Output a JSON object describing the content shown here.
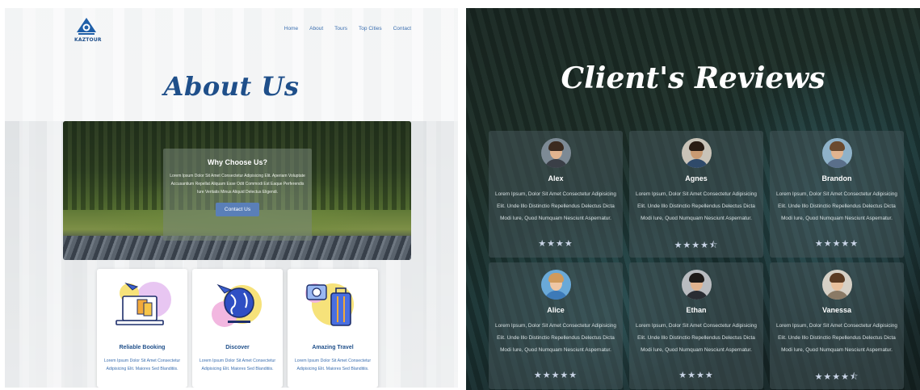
{
  "about": {
    "logo_text": "KAZTOUR",
    "nav": [
      "Home",
      "About",
      "Tours",
      "Top Cities",
      "Contact"
    ],
    "title": "About Us",
    "why": {
      "title": "Why Choose Us?",
      "text": "Lorem Ipsum Dolor Sit Amet Consectetur Adipisicing Elit. Aperiam Voluptate Accusantium Repellat Aliquam Esse Odit Commodi Est Eaque Perferendis Iure Veritatis Minus Aliquid Delectus Eligendi.",
      "button": "Contact Us"
    },
    "cards": [
      {
        "title": "Reliable Booking",
        "text": "Lorem Ipsum Dolor Sit Amet Consectetur Adipisicing Elit. Maiores Sed Blanditiis."
      },
      {
        "title": "Discover",
        "text": "Lorem Ipsum Dolor Sit Amet Consectetur Adipisicing Elit. Maiores Sed Blanditiis."
      },
      {
        "title": "Amazing Travel",
        "text": "Lorem Ipsum Dolor Sit Amet Consectetur Adipisicing Elit. Maiores Sed Blanditiis."
      }
    ]
  },
  "reviews": {
    "title": "Client's Reviews",
    "items": [
      {
        "name": "Alex",
        "text": "Lorem Ipsum, Dolor Sit Amet Consectetur Adipisicing Elit. Unde Illo Distinctio Repellendus Delectus Dicta Modi Iure, Quod Numquam Nesciunt Aspernatur.",
        "stars": "★★★★",
        "rating": 4
      },
      {
        "name": "Agnes",
        "text": "Lorem Ipsum, Dolor Sit Amet Consectetur Adipisicing Elit. Unde Illo Distinctio Repellendus Delectus Dicta Modi Iure, Quod Numquam Nesciunt Aspernatur.",
        "stars": "★★★★⯪",
        "rating": 4.5
      },
      {
        "name": "Brandon",
        "text": "Lorem Ipsum, Dolor Sit Amet Consectetur Adipisicing Elit. Unde Illo Distinctio Repellendus Delectus Dicta Modi Iure, Quod Numquam Nesciunt Aspernatur.",
        "stars": "★★★★★",
        "rating": 5
      },
      {
        "name": "Alice",
        "text": "Lorem Ipsum, Dolor Sit Amet Consectetur Adipisicing Elit. Unde Illo Distinctio Repellendus Delectus Dicta Modi Iure, Quod Numquam Nesciunt Aspernatur.",
        "stars": "★★★★★",
        "rating": 5
      },
      {
        "name": "Ethan",
        "text": "Lorem Ipsum, Dolor Sit Amet Consectetur Adipisicing Elit. Unde Illo Distinctio Repellendus Delectus Dicta Modi Iure, Quod Numquam Nesciunt Aspernatur.",
        "stars": "★★★★",
        "rating": 4
      },
      {
        "name": "Vanessa",
        "text": "Lorem Ipsum, Dolor Sit Amet Consectetur Adipisicing Elit. Unde Illo Distinctio Repellendus Delectus Dicta Modi Iure, Quod Numquam Nesciunt Aspernatur.",
        "stars": "★★★★⯪",
        "rating": 4.5
      }
    ]
  },
  "colors": {
    "brand_blue": "#1f4f8a",
    "link_blue": "#3b6fb0",
    "button_blue": "#5a7fb8",
    "star": "#c9d4e6"
  }
}
